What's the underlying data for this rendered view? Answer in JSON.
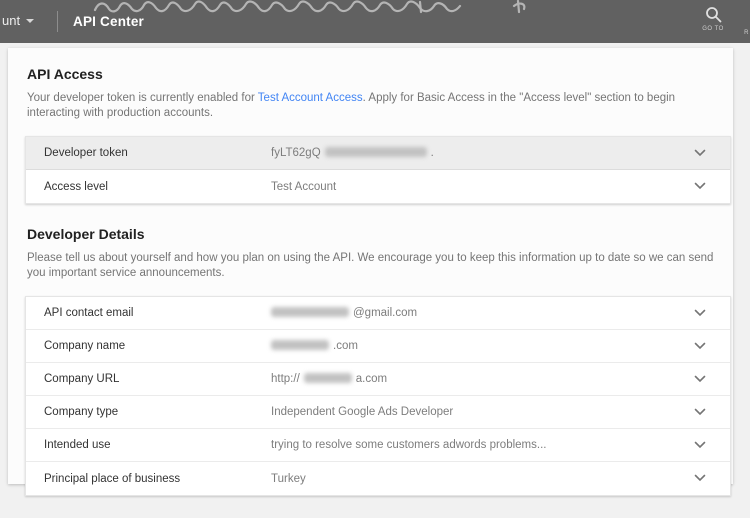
{
  "colors": {
    "header_bg": "#616161",
    "link": "#4285f4",
    "highlight_row": "#ededed"
  },
  "header": {
    "account_menu_label": "unt",
    "title": "API Center",
    "search_label": "GO TO",
    "right_edge_label": "R"
  },
  "api_access": {
    "heading": "API Access",
    "desc_before_link": "Your developer token is currently enabled for ",
    "link_text": "Test Account Access",
    "desc_after_link": ". Apply for Basic Access in the \"Access level\" section to begin interacting with production accounts.",
    "rows": [
      {
        "label": "Developer token",
        "value_prefix": "fyLT62gQ",
        "value_suffix": "."
      },
      {
        "label": "Access level",
        "value": "Test Account"
      }
    ]
  },
  "developer_details": {
    "heading": "Developer Details",
    "description": "Please tell us about yourself and how you plan on using the API. We encourage you to keep this information up to date so we can send you important service announcements.",
    "rows": [
      {
        "label": "API contact email",
        "value_prefix": "",
        "value_suffix": "@gmail.com"
      },
      {
        "label": "Company name",
        "value_prefix": "",
        "value_suffix": ".com"
      },
      {
        "label": "Company URL",
        "value_prefix": "http://",
        "value_suffix": "a.com"
      },
      {
        "label": "Company type",
        "value": "Independent Google Ads Developer"
      },
      {
        "label": "Intended use",
        "value": "trying to resolve some customers adwords problems..."
      },
      {
        "label": "Principal place of business",
        "value": "Turkey"
      }
    ]
  }
}
